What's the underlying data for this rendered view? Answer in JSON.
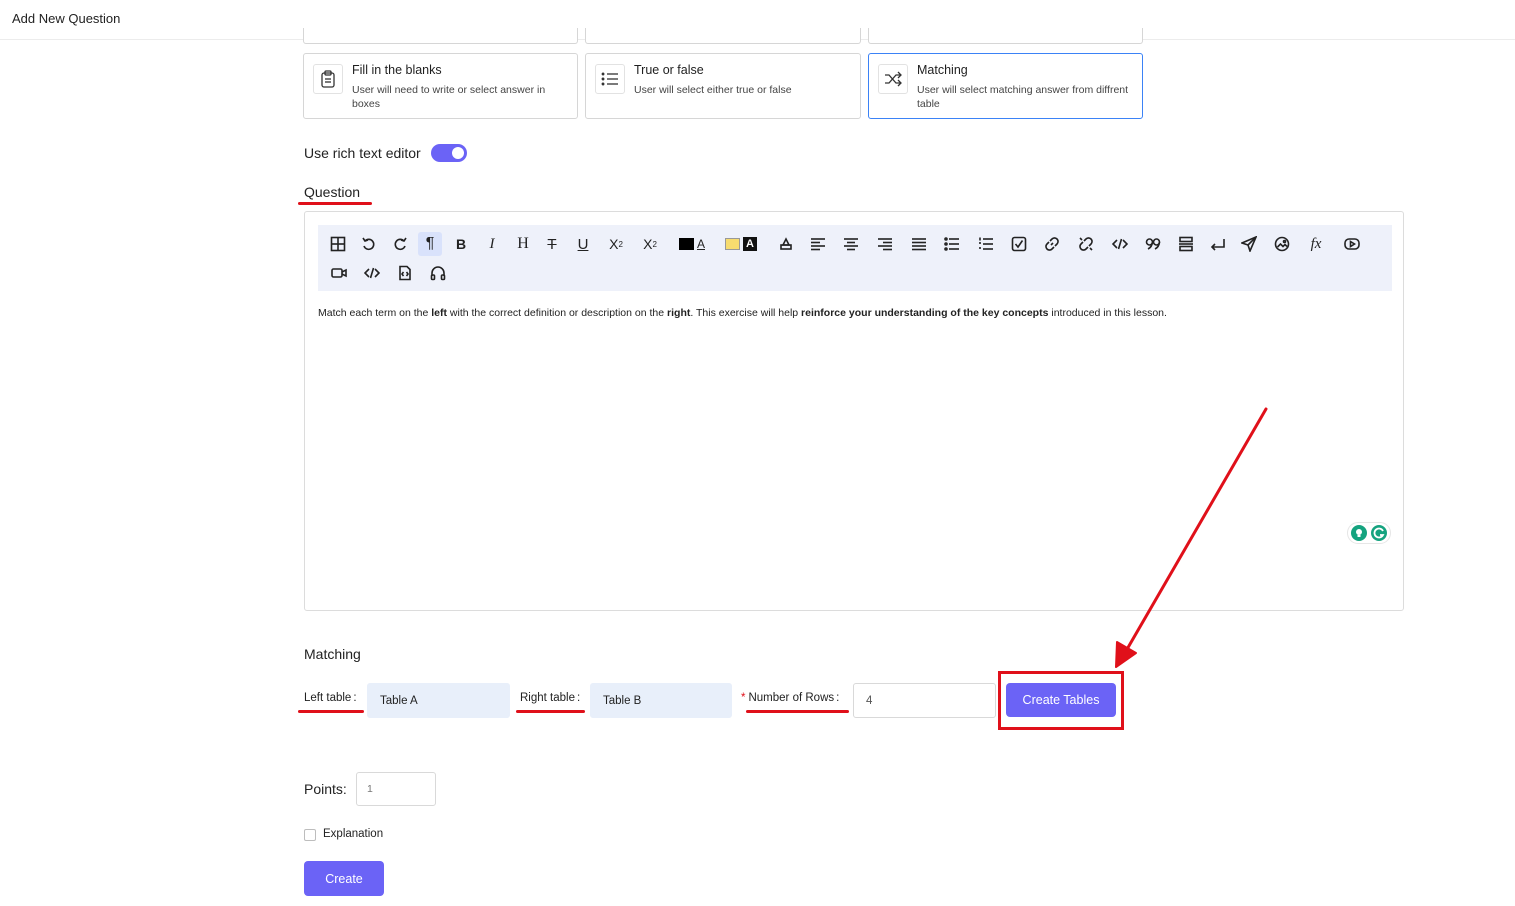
{
  "header": {
    "title": "Add New Question"
  },
  "question_types": [
    {
      "title": "Fill in the blanks",
      "description": "User will need to write or select answer in boxes",
      "icon": "clipboard-icon",
      "selected": false
    },
    {
      "title": "True or false",
      "description": "User will select either true or false",
      "icon": "list-icon",
      "selected": false
    },
    {
      "title": "Matching",
      "description": "User will select matching answer from diffrent table",
      "icon": "shuffle-icon",
      "selected": true
    }
  ],
  "rich_text": {
    "label": "Use rich text editor",
    "enabled": true
  },
  "question": {
    "label": "Question",
    "content": {
      "p1": "Match each term on the ",
      "b1": "left",
      "p2": " with the correct definition or description on the ",
      "b2": "right",
      "p3": ". This exercise will help ",
      "b3": "reinforce your understanding of the key concepts",
      "p4": " introduced in this lesson."
    }
  },
  "toolbar": {
    "buttons": [
      "table-icon",
      "undo-icon",
      "redo-icon",
      "paragraph-icon",
      "bold-icon",
      "italic-icon",
      "heading-icon",
      "strikethrough-icon",
      "underline-icon",
      "subscript-icon",
      "superscript-icon",
      "font-color-icon",
      "highlight-color-icon",
      "clear-format-icon",
      "align-left-icon",
      "align-center-icon",
      "align-right-icon",
      "justify-icon",
      "bullet-list-icon",
      "numbered-list-icon",
      "checklist-icon",
      "link-icon",
      "unlink-icon",
      "code-icon",
      "quote-icon",
      "horizontal-rule-icon",
      "line-break-icon",
      "send-icon",
      "image-icon",
      "formula-icon",
      "youtube-icon",
      "video-icon",
      "code-block-icon",
      "file-code-icon",
      "audio-icon"
    ],
    "glyphs": {
      "bold": "B",
      "italic": "I",
      "heading": "H",
      "strike": "T",
      "underline": "U",
      "subscript": "X",
      "sub_mark": "2",
      "superscript": "X",
      "sup_mark": "2",
      "letter_a": "A",
      "formula": "fx",
      "pilcrow": "¶"
    }
  },
  "matching": {
    "heading": "Matching",
    "left_table": {
      "label": "Left table",
      "separator": ":",
      "value": "Table A"
    },
    "right_table": {
      "label": "Right table",
      "separator": ":",
      "value": "Table B"
    },
    "rows": {
      "label": "Number of Rows",
      "separator": ":",
      "required_mark": "*",
      "value": "4"
    },
    "create_tables_label": "Create Tables"
  },
  "points": {
    "label": "Points:",
    "value": "1"
  },
  "explanation": {
    "label": "Explanation",
    "checked": false
  },
  "create_label": "Create",
  "colors": {
    "accent": "#6b63f6",
    "annotation": "#e0101a",
    "selected_border": "#3b82f6",
    "toolbar_bg": "#eef1fa"
  }
}
